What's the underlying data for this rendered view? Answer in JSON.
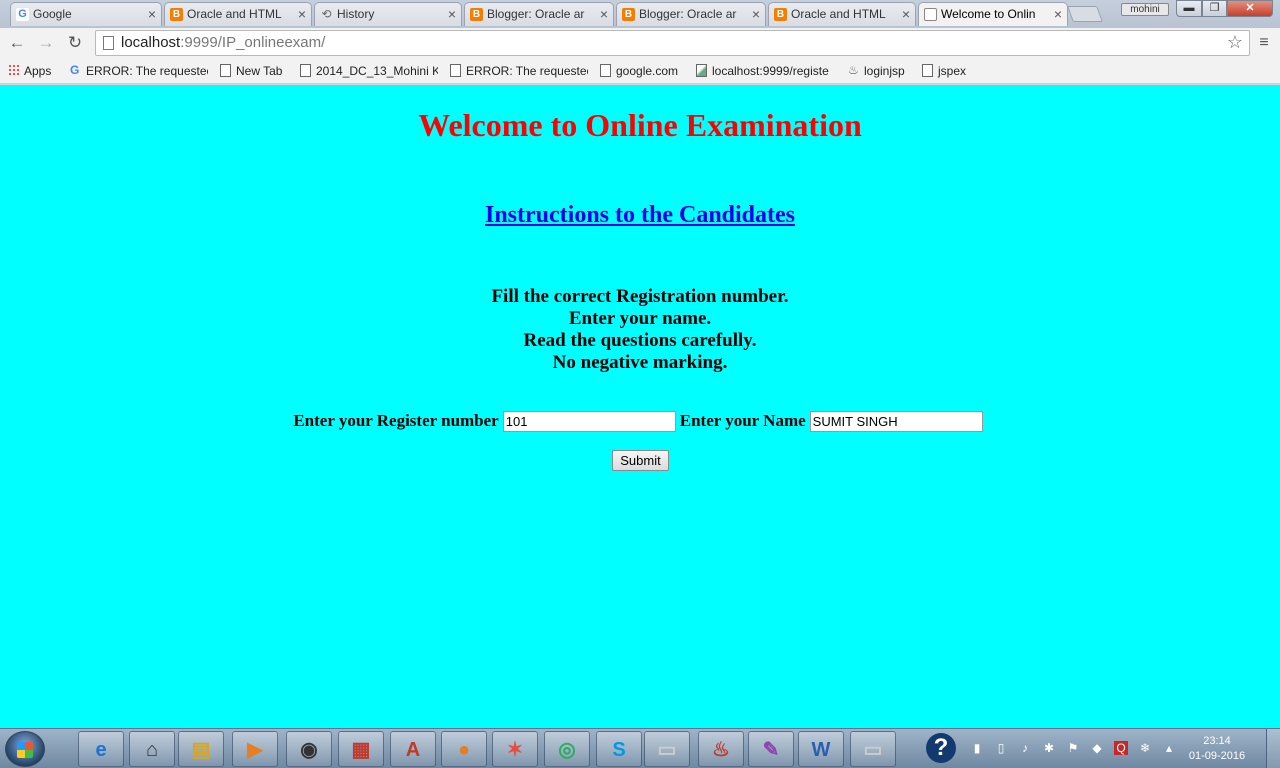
{
  "browser": {
    "tabs": [
      {
        "label": "Google",
        "icon": "google-icon"
      },
      {
        "label": "Oracle and HTML",
        "icon": "blogger-icon"
      },
      {
        "label": "History",
        "icon": "history-icon"
      },
      {
        "label": "Blogger: Oracle ar",
        "icon": "blogger-icon"
      },
      {
        "label": "Blogger: Oracle ar",
        "icon": "blogger-icon"
      },
      {
        "label": "Oracle and HTML",
        "icon": "blogger-icon"
      },
      {
        "label": "Welcome to Onlin",
        "icon": "page-icon"
      }
    ],
    "user": "mohini",
    "url_host": "localhost",
    "url_rest": ":9999/IP_onlineexam/",
    "bookmarks": [
      {
        "label": "Apps"
      },
      {
        "label": "ERROR: The requestec"
      },
      {
        "label": "New Tab"
      },
      {
        "label": "2014_DC_13_Mohini K"
      },
      {
        "label": "ERROR: The requestec"
      },
      {
        "label": "google.com"
      },
      {
        "label": "localhost:9999/registe"
      },
      {
        "label": "loginjsp"
      },
      {
        "label": "jspex"
      }
    ]
  },
  "page": {
    "title": "Welcome to Online Examination",
    "instructions_link": "Instructions to the Candidates",
    "instructions": [
      "Fill the correct Registration number.",
      "Enter your name.",
      "Read the questions carefully.",
      "No negative marking."
    ],
    "form": {
      "register_label": "Enter your Register number",
      "register_value": "101",
      "name_label": "Enter your Name",
      "name_value": "SUMIT SINGH",
      "submit_label": "Submit"
    },
    "background_color": "#00ffff",
    "title_color": "#ff0000"
  },
  "taskbar": {
    "time": "23:14",
    "date": "01-09-2016"
  }
}
